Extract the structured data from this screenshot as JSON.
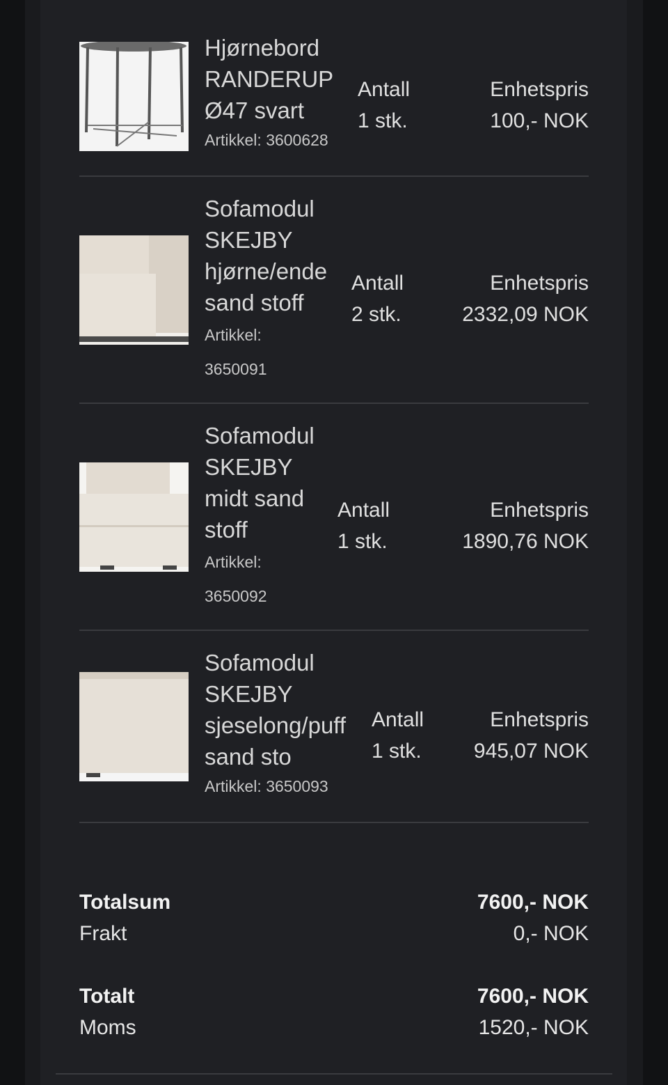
{
  "items": [
    {
      "name_lines": [
        "Hjørnebord",
        "RANDERUP",
        "Ø47 svart"
      ],
      "article_label": "Artikkel:",
      "article_number": "3600628",
      "qty_label": "Antall",
      "qty_value": "1 stk.",
      "price_label": "Enhetspris",
      "price_value": "100,- NOK",
      "image_icon": "corner-table-image"
    },
    {
      "name_lines": [
        "Sofamodul",
        "SKEJBY",
        "hjørne/ende",
        "sand stoff"
      ],
      "article_label": "Artikkel:",
      "article_number": "3650091",
      "qty_label": "Antall",
      "qty_value": "2 stk.",
      "price_label": "Enhetspris",
      "price_value": "2332,09 NOK",
      "image_icon": "sofa-corner-module-image"
    },
    {
      "name_lines": [
        "Sofamodul",
        "SKEJBY",
        "midt sand",
        "stoff"
      ],
      "article_label": "Artikkel:",
      "article_number": "3650092",
      "qty_label": "Antall",
      "qty_value": "1 stk.",
      "price_label": "Enhetspris",
      "price_value": "1890,76 NOK",
      "image_icon": "sofa-middle-module-image"
    },
    {
      "name_lines": [
        "Sofamodul",
        "SKEJBY",
        "sjeselong/puff",
        "sand sto"
      ],
      "article_label": "Artikkel:",
      "article_number": "3650093",
      "qty_label": "Antall",
      "qty_value": "1 stk.",
      "price_label": "Enhetspris",
      "price_value": "945,07 NOK",
      "image_icon": "sofa-ottoman-module-image"
    }
  ],
  "summary": {
    "totalsum_label": "Totalsum",
    "totalsum_value": "7600,- NOK",
    "frakt_label": "Frakt",
    "frakt_value": "0,- NOK",
    "totalt_label": "Totalt",
    "totalt_value": "7600,- NOK",
    "moms_label": "Moms",
    "moms_value": "1520,- NOK"
  },
  "colors": {
    "background": "#1f2024",
    "divider": "#3a3b3f",
    "text": "#e0e0e0"
  }
}
